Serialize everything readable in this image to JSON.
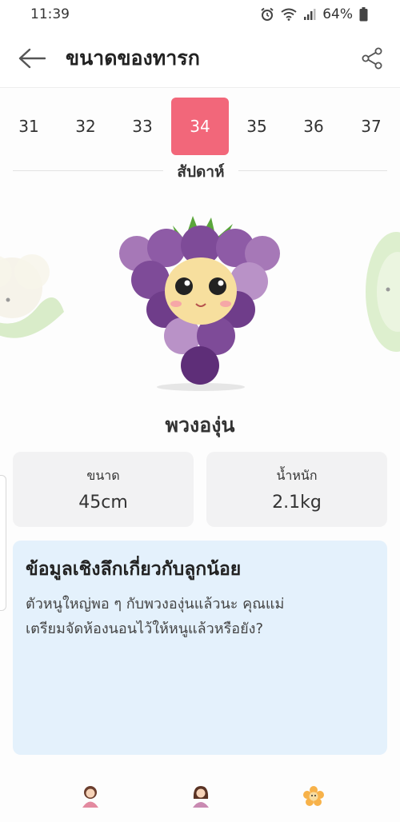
{
  "status_bar": {
    "time": "11:39",
    "battery": "64%",
    "icons": [
      "alarm-icon",
      "wifi-icon",
      "signal-icon",
      "battery-icon"
    ]
  },
  "header": {
    "title": "ขนาดของทารก",
    "back_icon": "arrow-left-icon",
    "share_icon": "share-icon"
  },
  "weeks": {
    "items": [
      "31",
      "32",
      "33",
      "34",
      "35",
      "36",
      "37"
    ],
    "selected": "34",
    "label": "สัปดาห์"
  },
  "fruit": {
    "name": "พวงองุ่น",
    "image": "grape-bunch-character"
  },
  "stats": {
    "size_label": "ขนาด",
    "size_value": "45cm",
    "weight_label": "น้ำหนัก",
    "weight_value": "2.1kg"
  },
  "insight": {
    "title": "ข้อมูลเชิงลึกเกี่ยวกับลูกน้อย",
    "line1": "ตัวหนูใหญ่พอ ๆ กับพวงองุ่นแล้วนะ คุณแม่",
    "line2": "เตรียมจัดห้องนอนไว้ให้หนูแล้วหรือยัง?"
  },
  "colors": {
    "accent": "#f2677a",
    "card_bg": "#f2f2f3",
    "insight_bg": "#e4f1fc"
  },
  "bottom_nav": [
    "mother-avatar-icon",
    "woman-avatar-icon",
    "flower-icon"
  ]
}
